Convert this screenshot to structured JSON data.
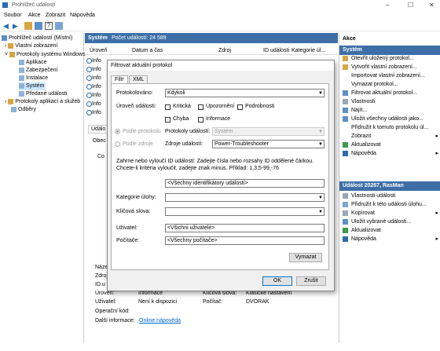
{
  "window": {
    "title": "Prohlížeč událostí",
    "controls": [
      "–",
      "☐",
      "✕"
    ]
  },
  "menu": [
    "Soubor",
    "Akce",
    "Zobrazit",
    "Nápověda"
  ],
  "tree": {
    "root": "Prohlížeč událostí (Místní)",
    "items": [
      {
        "label": "Vlastní zobrazení"
      },
      {
        "label": "Protokoly systému Windows"
      },
      {
        "label": "Aplikace"
      },
      {
        "label": "Zabezpečení"
      },
      {
        "label": "Instalace"
      },
      {
        "label": "Systém"
      },
      {
        "label": "Předané události"
      },
      {
        "label": "Protokoly aplikací a služeb"
      },
      {
        "label": "Odběry"
      }
    ]
  },
  "center": {
    "header_title": "Systém",
    "header_count": "Počet událostí: 24 589",
    "columns": [
      "Úroveň",
      "Datum a čas",
      "Zdroj",
      "ID události",
      "Kategorie úl..."
    ],
    "row_prefix": "Info",
    "tab_label": "Událo",
    "subtab": "Obec",
    "snippet": "Co"
  },
  "details": {
    "labels_left": [
      "Název",
      "Zdroj",
      "ID u",
      "Úroveň:",
      "Uživatel:",
      "Operační kód:",
      "Další informace:"
    ],
    "values_left": [
      "Informace",
      "Není k dispozici"
    ],
    "labels_right": [
      "Klíčová slova:",
      "Počítač:"
    ],
    "values_right": [
      "Klasické nastavení",
      "DVORAK"
    ],
    "link": "Online nápověda"
  },
  "actions": {
    "header1": "Akce",
    "section1": "Systém",
    "items1": [
      {
        "label": "Otevřít uložený protokol...",
        "icon": "folder-icon"
      },
      {
        "label": "Vytvořit vlastní zobrazení...",
        "icon": "filter-add-icon"
      },
      {
        "label": "Importovat vlastní zobrazení...",
        "icon": ""
      },
      {
        "label": "Vymazat protokol...",
        "icon": ""
      },
      {
        "label": "Filtrovat aktuální protokol...",
        "icon": "filter-icon"
      },
      {
        "label": "Vlastnosti",
        "icon": "properties-icon"
      },
      {
        "label": "Najít...",
        "icon": "find-icon"
      },
      {
        "label": "Uložit všechny události jako...",
        "icon": "save-icon"
      },
      {
        "label": "Přidružit k tomuto protokolu úl...",
        "icon": ""
      },
      {
        "label": "Zobrazit",
        "icon": "",
        "arrow": true
      },
      {
        "label": "Aktualizovat",
        "icon": "refresh-icon"
      },
      {
        "label": "Nápověda",
        "icon": "help-icon",
        "arrow": true
      }
    ],
    "section2": "Událost 20267, RasMan",
    "items2": [
      {
        "label": "Vlastnosti události",
        "icon": "properties-icon"
      },
      {
        "label": "Přidružit k této události úlohu...",
        "icon": "task-icon"
      },
      {
        "label": "Kopírovat",
        "icon": "copy-icon",
        "arrow": true
      },
      {
        "label": "Uložit vybrané události...",
        "icon": "save-icon"
      },
      {
        "label": "Aktualizovat",
        "icon": "refresh-icon"
      },
      {
        "label": "Nápověda",
        "icon": "help-icon",
        "arrow": true
      }
    ]
  },
  "dialog": {
    "title": "Filtrovat aktuální protokol",
    "tabs": [
      "Filtr",
      "XML"
    ],
    "logged_label": "Protokolováno:",
    "logged_value": "Kdykoli",
    "level_label": "Úroveň události:",
    "levels": [
      "Kritická",
      "Upozornění",
      "Podrobnosti",
      "Chyba",
      "Informace"
    ],
    "by_log": "Podle protokolu",
    "by_source": "Podle zdroje",
    "logs_label": "Protokoly událostí:",
    "logs_value": "Systém",
    "sources_label": "Zdroje událostí:",
    "sources_value": "Power-Troubleshooter",
    "help_text": "Zahrne nebo vyloučí ID událostí: Zadejte čísla nebo rozsahy ID oddělené čárkou. Chcete-li kritéria vyloučit, zadejte znak minus. Příklad: 1,3,5-99,-76",
    "ids_value": "<Všechny identifikátory událostí>",
    "task_label": "Kategorie úlohy:",
    "keywords_label": "Klíčová slova:",
    "user_label": "Uživatel:",
    "user_value": "<Všichni uživatelé>",
    "computer_label": "Počítače:",
    "computer_value": "<Všechny počítače>",
    "clear_button": "Vymazat",
    "ok_button": "OK",
    "cancel_button": "Zrušit"
  }
}
